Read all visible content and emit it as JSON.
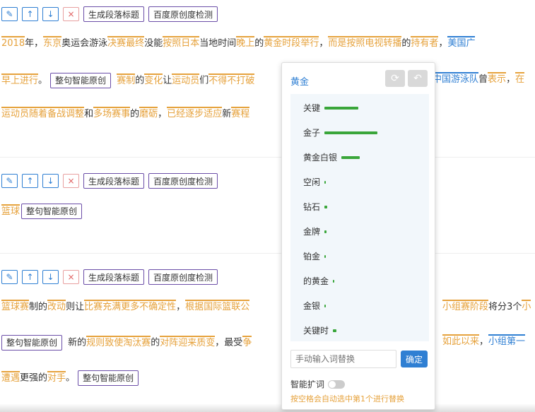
{
  "toolbar": {
    "edit_icon": "pencil-icon",
    "up_icon": "arrow-up-icon",
    "down_icon": "arrow-down-icon",
    "delete_icon": "close-icon",
    "gen_title_label": "生成段落标题",
    "baidu_check_label": "百度原创度检测"
  },
  "smart_original_label": "整句智能原创",
  "para1": {
    "l1": [
      "2018",
      "年，",
      "东京",
      "奥运会",
      "游泳",
      "决赛",
      "最终",
      "没能",
      "按照",
      "日本",
      "当地时间",
      "晚上",
      "的",
      "黄金",
      "时段",
      "举行",
      "，",
      "而是",
      "按照",
      "电视",
      "转播",
      "的",
      "持有者",
      "，",
      "美国广"
    ],
    "l2a": [
      "早上",
      "进行",
      "。"
    ],
    "l2b": [
      "赛制",
      "的",
      "变化",
      "让",
      "运动员",
      "们",
      "不得不",
      "打破"
    ],
    "l2c": [
      "中国",
      "游泳队",
      "曾",
      "表示",
      "，",
      "在"
    ],
    "l3": [
      "运动员",
      "随着",
      "备战",
      "调整",
      "和",
      "多场",
      "赛事",
      "的",
      "磨砺",
      "，",
      "已经",
      "逐步",
      "适应",
      "新",
      "赛程"
    ]
  },
  "para2": {
    "l1": [
      "篮球"
    ]
  },
  "para3": {
    "l1": [
      "篮球赛",
      "制",
      "的",
      "改动",
      "则",
      "让",
      "比赛",
      "充满",
      "更多",
      "不确定性",
      "，",
      "根据",
      "国际",
      "篮联",
      "公"
    ],
    "l1r": [
      "小组赛",
      "阶段",
      "将分",
      "3个",
      "小"
    ],
    "l2": [
      "新的",
      "规则",
      "致使",
      "淘汰赛",
      "的",
      "对阵",
      "迎来",
      "质变",
      "，",
      "最受",
      "争"
    ],
    "l2r": [
      "如此",
      "以来",
      "，",
      "小组第一"
    ],
    "l3": [
      "遭遇",
      "更强的",
      "对手",
      "。"
    ]
  },
  "popup": {
    "title": "黄金",
    "refresh_icon": "refresh-icon",
    "undo_icon": "undo-icon",
    "items": [
      {
        "label": "关键",
        "score": 0.55
      },
      {
        "label": "金子",
        "score": 0.85
      },
      {
        "label": "黄金白银",
        "score": 0.3
      },
      {
        "label": "空闲",
        "score": 0.02
      },
      {
        "label": "钻石",
        "score": 0.04
      },
      {
        "label": "金牌",
        "score": 0.03
      },
      {
        "label": "铂金",
        "score": 0.02
      },
      {
        "label": "的黄金",
        "score": 0.02
      },
      {
        "label": "金银",
        "score": 0.02
      },
      {
        "label": "关键时",
        "score": 0.06
      }
    ],
    "input_placeholder": "手动输入词替换",
    "confirm_label": "确定",
    "smart_expand_label": "智能扩词",
    "hint": "按空格会自动选中第1个进行替换"
  }
}
